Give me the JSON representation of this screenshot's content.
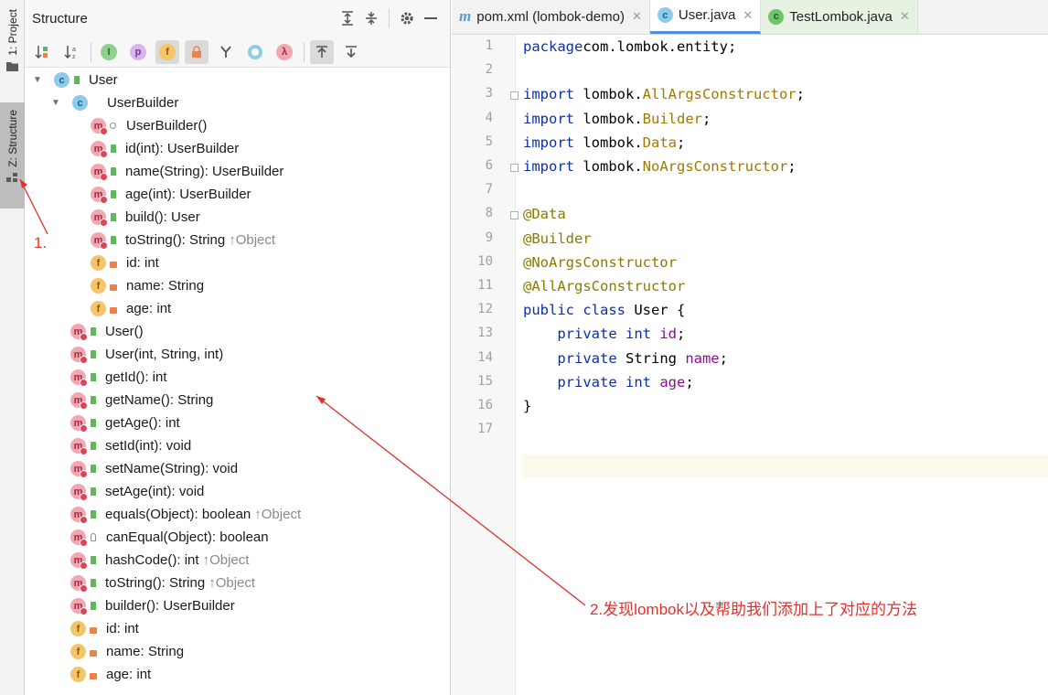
{
  "toolstrip": {
    "project_tab": "1: Project",
    "structure_tab": "Z: Structure"
  },
  "structure": {
    "title": "Structure",
    "toolbar_badges": [
      "I",
      "p",
      "f",
      "λ"
    ]
  },
  "tree": [
    {
      "indent": 0,
      "arrow": "▼",
      "icon": "c",
      "vis": "pub",
      "text": "User",
      "inherit": ""
    },
    {
      "indent": 1,
      "arrow": "▼",
      "icon": "c",
      "vis": "",
      "text": "UserBuilder",
      "inherit": ""
    },
    {
      "indent": 2,
      "arrow": "",
      "icon": "m",
      "vis": "pkg",
      "text": "UserBuilder()",
      "inherit": ""
    },
    {
      "indent": 2,
      "arrow": "",
      "icon": "m",
      "vis": "pub",
      "text": "id(int): UserBuilder",
      "inherit": ""
    },
    {
      "indent": 2,
      "arrow": "",
      "icon": "m",
      "vis": "pub",
      "text": "name(String): UserBuilder",
      "inherit": ""
    },
    {
      "indent": 2,
      "arrow": "",
      "icon": "m",
      "vis": "pub",
      "text": "age(int): UserBuilder",
      "inherit": ""
    },
    {
      "indent": 2,
      "arrow": "",
      "icon": "m",
      "vis": "pub",
      "text": "build(): User",
      "inherit": ""
    },
    {
      "indent": 2,
      "arrow": "",
      "icon": "m",
      "vis": "pub",
      "text": "toString(): String",
      "inherit": "↑Object"
    },
    {
      "indent": 2,
      "arrow": "",
      "icon": "f",
      "vis": "priv",
      "text": "id: int",
      "inherit": ""
    },
    {
      "indent": 2,
      "arrow": "",
      "icon": "f",
      "vis": "priv",
      "text": "name: String",
      "inherit": ""
    },
    {
      "indent": 2,
      "arrow": "",
      "icon": "f",
      "vis": "priv",
      "text": "age: int",
      "inherit": ""
    },
    {
      "indent": 3,
      "arrow": "",
      "icon": "m",
      "vis": "pub",
      "text": "User()",
      "inherit": ""
    },
    {
      "indent": 3,
      "arrow": "",
      "icon": "m",
      "vis": "pub",
      "text": "User(int, String, int)",
      "inherit": ""
    },
    {
      "indent": 3,
      "arrow": "",
      "icon": "m",
      "vis": "pub",
      "text": "getId(): int",
      "inherit": ""
    },
    {
      "indent": 3,
      "arrow": "",
      "icon": "m",
      "vis": "pub",
      "text": "getName(): String",
      "inherit": ""
    },
    {
      "indent": 3,
      "arrow": "",
      "icon": "m",
      "vis": "pub",
      "text": "getAge(): int",
      "inherit": ""
    },
    {
      "indent": 3,
      "arrow": "",
      "icon": "m",
      "vis": "pub",
      "text": "setId(int): void",
      "inherit": ""
    },
    {
      "indent": 3,
      "arrow": "",
      "icon": "m",
      "vis": "pub",
      "text": "setName(String): void",
      "inherit": ""
    },
    {
      "indent": 3,
      "arrow": "",
      "icon": "m",
      "vis": "pub",
      "text": "setAge(int): void",
      "inherit": ""
    },
    {
      "indent": 3,
      "arrow": "",
      "icon": "m",
      "vis": "pub",
      "text": "equals(Object): boolean",
      "inherit": "↑Object"
    },
    {
      "indent": 3,
      "arrow": "",
      "icon": "m",
      "vis": "prot",
      "text": "canEqual(Object): boolean",
      "inherit": ""
    },
    {
      "indent": 3,
      "arrow": "",
      "icon": "m",
      "vis": "pub",
      "text": "hashCode(): int",
      "inherit": "↑Object"
    },
    {
      "indent": 3,
      "arrow": "",
      "icon": "m",
      "vis": "pub",
      "text": "toString(): String",
      "inherit": "↑Object"
    },
    {
      "indent": 3,
      "arrow": "",
      "icon": "m",
      "vis": "pub",
      "text": "builder(): UserBuilder",
      "inherit": ""
    },
    {
      "indent": 3,
      "arrow": "",
      "icon": "f",
      "vis": "priv",
      "text": "id: int",
      "inherit": ""
    },
    {
      "indent": 3,
      "arrow": "",
      "icon": "f",
      "vis": "priv",
      "text": "name: String",
      "inherit": ""
    },
    {
      "indent": 3,
      "arrow": "",
      "icon": "f",
      "vis": "priv",
      "text": "age: int",
      "inherit": ""
    }
  ],
  "editor": {
    "tabs": [
      {
        "label": "pom.xml (lombok-demo)",
        "icon": "m"
      },
      {
        "label": "User.java",
        "icon": "c"
      },
      {
        "label": "TestLombok.java",
        "icon": "c"
      }
    ],
    "line_numbers": [
      "1",
      "2",
      "3",
      "4",
      "5",
      "6",
      "7",
      "8",
      "9",
      "10",
      "11",
      "12",
      "13",
      "14",
      "15",
      "16",
      "17"
    ],
    "code_lines": [
      [
        [
          "kw",
          "package"
        ],
        [
          "",
          "com.lombok.entity;"
        ]
      ],
      [],
      [
        [
          "kw",
          "import"
        ],
        [
          "",
          " lombok."
        ],
        [
          "imp",
          "AllArgsConstructor"
        ],
        [
          "",
          ";"
        ]
      ],
      [
        [
          "kw",
          "import"
        ],
        [
          "",
          " lombok."
        ],
        [
          "imp",
          "Builder"
        ],
        [
          "",
          ";"
        ]
      ],
      [
        [
          "kw",
          "import"
        ],
        [
          "",
          " lombok."
        ],
        [
          "imp",
          "Data"
        ],
        [
          "",
          ";"
        ]
      ],
      [
        [
          "kw",
          "import"
        ],
        [
          "",
          " lombok."
        ],
        [
          "imp",
          "NoArgsConstructor"
        ],
        [
          "",
          ";"
        ]
      ],
      [],
      [
        [
          "ann",
          "@Data"
        ]
      ],
      [
        [
          "ann",
          "@Builder"
        ]
      ],
      [
        [
          "ann",
          "@NoArgsConstructor"
        ]
      ],
      [
        [
          "ann",
          "@AllArgsConstructor"
        ]
      ],
      [
        [
          "kw",
          "public class"
        ],
        [
          "",
          " User {"
        ]
      ],
      [
        [
          "",
          "    "
        ],
        [
          "kw",
          "private int"
        ],
        [
          "",
          " "
        ],
        [
          "fld",
          "id"
        ],
        [
          "",
          ";"
        ]
      ],
      [
        [
          "",
          "    "
        ],
        [
          "kw",
          "private"
        ],
        [
          "",
          " String "
        ],
        [
          "fld",
          "name"
        ],
        [
          "",
          ";"
        ]
      ],
      [
        [
          "",
          "    "
        ],
        [
          "kw",
          "private int"
        ],
        [
          "",
          " "
        ],
        [
          "fld",
          "age"
        ],
        [
          "",
          ";"
        ]
      ],
      [
        [
          "",
          "}"
        ]
      ],
      []
    ]
  },
  "annotations": {
    "label_1": "1.",
    "label_2": "2.发现lombok以及帮助我们添加上了对应的方法",
    "color": "#e0312c"
  }
}
